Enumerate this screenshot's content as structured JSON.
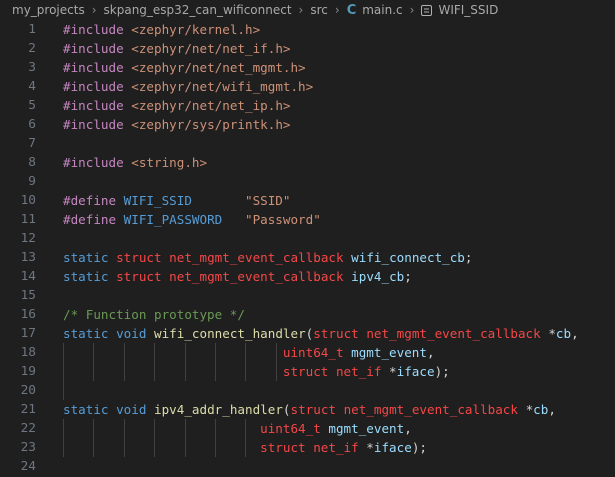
{
  "breadcrumb": {
    "items": [
      "my_projects",
      "skpang_esp32_can_wificonnect",
      "src",
      "main.c",
      "WIFI_SSID"
    ],
    "icons": {
      "file_icon_glyph": "C",
      "file_icon_name": "c-language-icon",
      "symbol_icon_name": "symbol-constant-icon"
    }
  },
  "editor": {
    "lines": [
      {
        "num": "1",
        "tokens": [
          {
            "t": "#include",
            "c": "kw-purple"
          },
          {
            "t": " <zephyr/kernel.h>",
            "c": "t-str"
          }
        ]
      },
      {
        "num": "2",
        "tokens": [
          {
            "t": "#include",
            "c": "kw-purple"
          },
          {
            "t": " <zephyr/net/net_if.h>",
            "c": "t-str"
          }
        ]
      },
      {
        "num": "3",
        "tokens": [
          {
            "t": "#include",
            "c": "kw-purple"
          },
          {
            "t": " <zephyr/net/net_mgmt.h>",
            "c": "t-str"
          }
        ]
      },
      {
        "num": "4",
        "tokens": [
          {
            "t": "#include",
            "c": "kw-purple"
          },
          {
            "t": " <zephyr/net/wifi_mgmt.h>",
            "c": "t-str"
          }
        ]
      },
      {
        "num": "5",
        "tokens": [
          {
            "t": "#include",
            "c": "kw-purple"
          },
          {
            "t": " <zephyr/net/net_ip.h>",
            "c": "t-str"
          }
        ]
      },
      {
        "num": "6",
        "tokens": [
          {
            "t": "#include",
            "c": "kw-purple"
          },
          {
            "t": " <zephyr/sys/printk.h>",
            "c": "t-str"
          }
        ]
      },
      {
        "num": "7",
        "tokens": []
      },
      {
        "num": "8",
        "tokens": [
          {
            "t": "#include",
            "c": "kw-purple"
          },
          {
            "t": " <string.h>",
            "c": "t-str"
          }
        ]
      },
      {
        "num": "9",
        "tokens": []
      },
      {
        "num": "10",
        "tokens": [
          {
            "t": "#define",
            "c": "kw-purple"
          },
          {
            "t": " WIFI_SSID",
            "c": "kw-blue"
          },
          {
            "t": "       \"SSID\"",
            "c": "t-str"
          }
        ]
      },
      {
        "num": "11",
        "tokens": [
          {
            "t": "#define",
            "c": "kw-purple"
          },
          {
            "t": " WIFI_PASSWORD",
            "c": "kw-blue"
          },
          {
            "t": "   \"Password\"",
            "c": "t-str"
          }
        ]
      },
      {
        "num": "12",
        "tokens": []
      },
      {
        "num": "13",
        "tokens": [
          {
            "t": "static",
            "c": "kw-blue"
          },
          {
            "t": " ",
            "c": "t-plain"
          },
          {
            "t": "struct",
            "c": "kw-red"
          },
          {
            "t": " net_mgmt_event_callback",
            "c": "kw-red"
          },
          {
            "t": " wifi_connect_cb",
            "c": "t-id"
          },
          {
            "t": ";",
            "c": "t-plain"
          }
        ]
      },
      {
        "num": "14",
        "tokens": [
          {
            "t": "static",
            "c": "kw-blue"
          },
          {
            "t": " ",
            "c": "t-plain"
          },
          {
            "t": "struct",
            "c": "kw-red"
          },
          {
            "t": " net_mgmt_event_callback",
            "c": "kw-red"
          },
          {
            "t": " ipv4_cb",
            "c": "t-id"
          },
          {
            "t": ";",
            "c": "t-plain"
          }
        ]
      },
      {
        "num": "15",
        "tokens": []
      },
      {
        "num": "16",
        "tokens": [
          {
            "t": "/* Function prototype */",
            "c": "t-com"
          }
        ]
      },
      {
        "num": "17",
        "tokens": [
          {
            "t": "static",
            "c": "kw-blue"
          },
          {
            "t": " void",
            "c": "kw-blue"
          },
          {
            "t": " wifi_connect_handler",
            "c": "t-fn"
          },
          {
            "t": "(",
            "c": "t-plain"
          },
          {
            "t": "struct",
            "c": "kw-red"
          },
          {
            "t": " net_mgmt_event_callback",
            "c": "kw-red"
          },
          {
            "t": " *",
            "c": "t-plain"
          },
          {
            "t": "cb",
            "c": "t-id"
          },
          {
            "t": ",",
            "c": "t-plain"
          }
        ]
      },
      {
        "num": "18",
        "guides": 8,
        "tokens": [
          {
            "t": "                             ",
            "c": "t-plain"
          },
          {
            "t": "uint64_t",
            "c": "kw-red"
          },
          {
            "t": " mgmt_event",
            "c": "t-id"
          },
          {
            "t": ",",
            "c": "t-plain"
          }
        ]
      },
      {
        "num": "19",
        "guides": 8,
        "tokens": [
          {
            "t": "                             ",
            "c": "t-plain"
          },
          {
            "t": "struct",
            "c": "kw-red"
          },
          {
            "t": " net_if",
            "c": "kw-red"
          },
          {
            "t": " *",
            "c": "t-plain"
          },
          {
            "t": "iface",
            "c": "t-id"
          },
          {
            "t": ");",
            "c": "t-plain"
          }
        ]
      },
      {
        "num": "20",
        "guides": 1,
        "tokens": []
      },
      {
        "num": "21",
        "tokens": [
          {
            "t": "static",
            "c": "kw-blue"
          },
          {
            "t": " void",
            "c": "kw-blue"
          },
          {
            "t": " ipv4_addr_handler",
            "c": "t-fn"
          },
          {
            "t": "(",
            "c": "t-plain"
          },
          {
            "t": "struct",
            "c": "kw-red"
          },
          {
            "t": " net_mgmt_event_callback",
            "c": "kw-red"
          },
          {
            "t": " *",
            "c": "t-plain"
          },
          {
            "t": "cb",
            "c": "t-id"
          },
          {
            "t": ",",
            "c": "t-plain"
          }
        ]
      },
      {
        "num": "22",
        "guides": 7,
        "tokens": [
          {
            "t": "                          ",
            "c": "t-plain"
          },
          {
            "t": "uint64_t",
            "c": "kw-red"
          },
          {
            "t": " mgmt_event",
            "c": "t-id"
          },
          {
            "t": ",",
            "c": "t-plain"
          }
        ]
      },
      {
        "num": "23",
        "guides": 7,
        "tokens": [
          {
            "t": "                          ",
            "c": "t-plain"
          },
          {
            "t": "struct",
            "c": "kw-red"
          },
          {
            "t": " net_if",
            "c": "kw-red"
          },
          {
            "t": " *",
            "c": "t-plain"
          },
          {
            "t": "iface",
            "c": "t-id"
          },
          {
            "t": ");",
            "c": "t-plain"
          }
        ]
      },
      {
        "num": "24",
        "tokens": []
      }
    ]
  }
}
